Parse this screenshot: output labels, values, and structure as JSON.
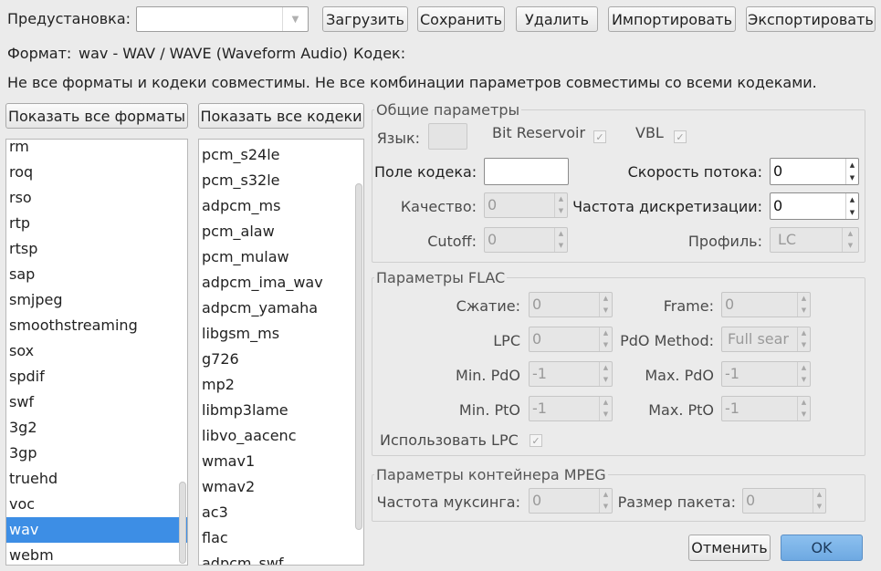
{
  "top": {
    "preset_label": "Предустановка:",
    "preset_value": "",
    "load_button": "Загрузить",
    "save_button": "Сохранить",
    "delete_button": "Удалить",
    "import_button": "Импортировать",
    "export_button": "Экспортировать"
  },
  "info": {
    "format_label": "Формат:",
    "format_value": "wav - WAV / WAVE (Waveform Audio)",
    "codec_label": "Кодек:",
    "warning": "Не все форматы и кодеки совместимы. Не все комбинации параметров совместимы со всеми кодеками."
  },
  "formats": {
    "show_all_button": "Показать все форматы",
    "items": [
      "rm",
      "roq",
      "rso",
      "rtp",
      "rtsp",
      "sap",
      "smjpeg",
      "smoothstreaming",
      "sox",
      "spdif",
      "swf",
      "3g2",
      "3gp",
      "truehd",
      "voc",
      "wav",
      "webm"
    ],
    "selected": "wav"
  },
  "codecs": {
    "show_all_button": "Показать все кодеки",
    "items": [
      "pcm_s24le",
      "pcm_s32le",
      "adpcm_ms",
      "pcm_alaw",
      "pcm_mulaw",
      "adpcm_ima_wav",
      "adpcm_yamaha",
      "libgsm_ms",
      "g726",
      "mp2",
      "libmp3lame",
      "libvo_aacenc",
      "wmav1",
      "wmav2",
      "ac3",
      "flac",
      "adpcm_swf"
    ]
  },
  "general": {
    "title": "Общие параметры",
    "language_label": "Язык:",
    "bit_reservoir_label": "Bit Reservoir",
    "vbl_label": "VBL",
    "codec_field_label": "Поле кодека:",
    "codec_field_value": "",
    "bitrate_label": "Скорость потока:",
    "bitrate_value": "0",
    "quality_label": "Качество:",
    "quality_value": "0",
    "samplerate_label": "Частота дискретизации:",
    "samplerate_value": "0",
    "cutoff_label": "Cutoff:",
    "cutoff_value": "0",
    "profile_label": "Профиль:",
    "profile_value": "LC"
  },
  "flac": {
    "title": "Параметры FLAC",
    "compression_label": "Сжатие:",
    "compression_value": "0",
    "frame_label": "Frame:",
    "frame_value": "0",
    "lpc_label": "LPC",
    "lpc_value": "0",
    "pdo_method_label": "PdO Method:",
    "pdo_method_value": "Full sear",
    "min_pdo_label": "Min. PdO",
    "min_pdo_value": "-1",
    "max_pdo_label": "Max. PdO",
    "max_pdo_value": "-1",
    "min_pto_label": "Min. PtO",
    "min_pto_value": "-1",
    "max_pto_label": "Max. PtO",
    "max_pto_value": "-1",
    "use_lpc_label": "Использовать LPC"
  },
  "mpeg": {
    "title": "Параметры контейнера MPEG",
    "mux_rate_label": "Частота муксинга:",
    "mux_rate_value": "0",
    "packet_size_label": "Размер пакета:",
    "packet_size_value": "0"
  },
  "dialog": {
    "cancel_button": "Отменить",
    "ok_button": "OK"
  },
  "icons": {
    "dropdown": "chevron-down-icon",
    "check": "checkmark-icon",
    "spin_up": "arrow-up-icon",
    "spin_down": "arrow-down-icon"
  },
  "colors": {
    "selection": "#3d8ee5",
    "ok_button": "#7ab3e8",
    "window_bg": "#ebebeb"
  }
}
